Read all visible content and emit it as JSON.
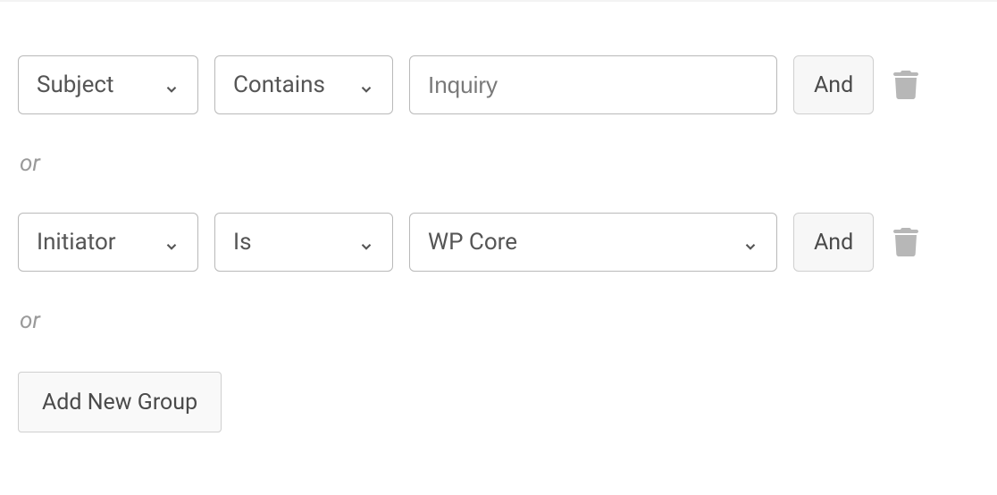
{
  "rules": [
    {
      "field": "Subject",
      "operator": "Contains",
      "value": "Inquiry",
      "value_type": "text",
      "connector": "And"
    },
    {
      "field": "Initiator",
      "operator": "Is",
      "value": "WP Core",
      "value_type": "select",
      "connector": "And"
    }
  ],
  "separator_label": "or",
  "add_group_label": "Add New Group"
}
